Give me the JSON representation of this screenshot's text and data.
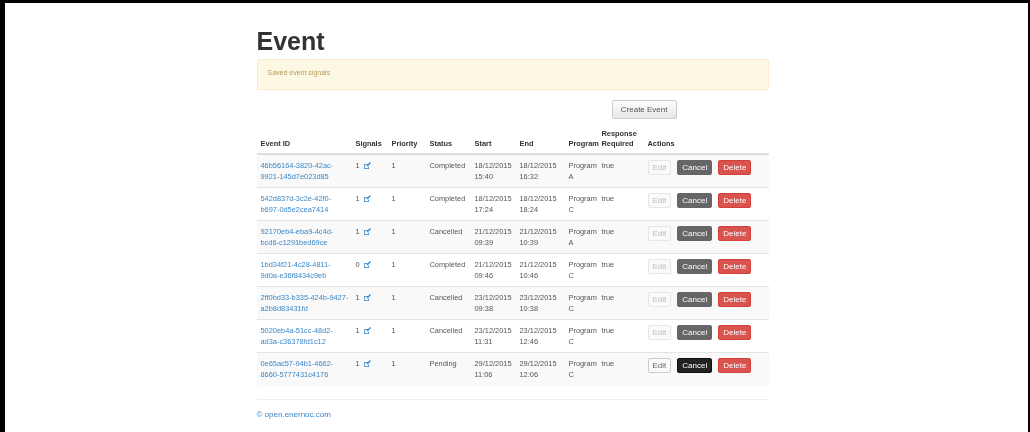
{
  "title": "Event",
  "alert": "Saved event signals",
  "create_button": "Create Event",
  "columns": [
    "Event ID",
    "Signals",
    "Priority",
    "Status",
    "Start",
    "End",
    "Program",
    "Response Required",
    "Actions"
  ],
  "rows": [
    {
      "id": "46b56164-3820-42ac-9921-145d7e023d85",
      "signals": "1",
      "priority": "1",
      "status": "Completed",
      "start": "18/12/2015 15:40",
      "end": "18/12/2015 16:32",
      "program": "Program A",
      "response": "true",
      "edit": "Edit",
      "cancel": "Cancel",
      "delete": "Delete",
      "disabled": true
    },
    {
      "id": "542d837d-3c2e-42f0-b697-0d5e2cea7414",
      "signals": "1",
      "priority": "1",
      "status": "Completed",
      "start": "18/12/2015 17:24",
      "end": "18/12/2015 18:24",
      "program": "Program C",
      "response": "true",
      "edit": "Edit",
      "cancel": "Cancel",
      "delete": "Delete",
      "disabled": true
    },
    {
      "id": "92170eb4-eba9-4c4d-bcd6-c1291bed69ce",
      "signals": "1",
      "priority": "1",
      "status": "Cancelled",
      "start": "21/12/2015 09:39",
      "end": "21/12/2015 10:39",
      "program": "Program A",
      "response": "true",
      "edit": "Edit",
      "cancel": "Cancel",
      "delete": "Delete",
      "disabled": true
    },
    {
      "id": "1bd34f21-4c28-4811-9d0a-e36f8434c9eb",
      "signals": "0",
      "priority": "1",
      "status": "Completed",
      "start": "21/12/2015 09:46",
      "end": "21/12/2015 10:46",
      "program": "Program C",
      "response": "true",
      "edit": "Edit",
      "cancel": "Cancel",
      "delete": "Delete",
      "disabled": true
    },
    {
      "id": "2ff0bd33-b335-424b-9427-a2b8d83431fd",
      "signals": "1",
      "priority": "1",
      "status": "Cancelled",
      "start": "23/12/2015 09:38",
      "end": "23/12/2015 10:38",
      "program": "Program C",
      "response": "true",
      "edit": "Edit",
      "cancel": "Cancel",
      "delete": "Delete",
      "disabled": true
    },
    {
      "id": "5020eb4a-51cc-48d2-ad3a-c36378fd1c12",
      "signals": "1",
      "priority": "1",
      "status": "Cancelled",
      "start": "23/12/2015 11:31",
      "end": "23/12/2015 12:46",
      "program": "Program C",
      "response": "true",
      "edit": "Edit",
      "cancel": "Cancel",
      "delete": "Delete",
      "disabled": true
    },
    {
      "id": "0e65ac57-94b1-4662-8660-5777431c4176",
      "signals": "1",
      "priority": "1",
      "status": "Pending",
      "start": "29/12/2015 11:06",
      "end": "29/12/2015 12:06",
      "program": "Program C",
      "response": "true",
      "edit": "Edit",
      "cancel": "Cancel",
      "delete": "Delete",
      "disabled": false
    }
  ],
  "footer": "© open.enernoc.com"
}
